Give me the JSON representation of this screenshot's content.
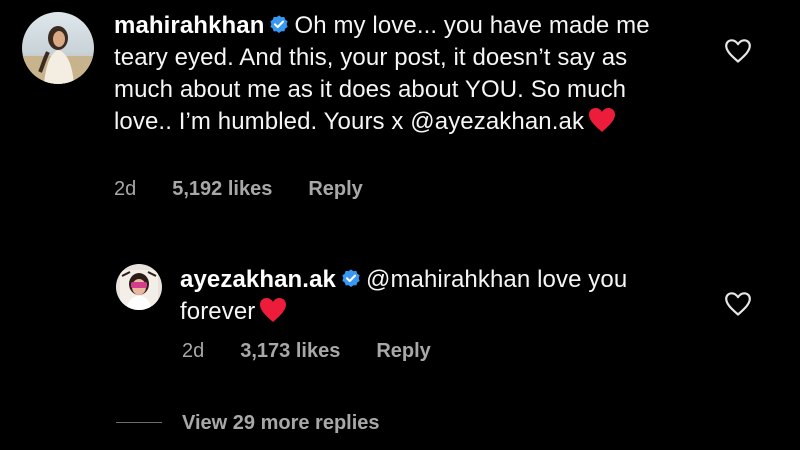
{
  "comment": {
    "username": "mahirahkhan",
    "text": "Oh my love... you have made me teary eyed. And this, your post, it doesn’t say as much about me as it does about YOU. So much love.. I’m humbled. Yours x @ayezakhan.ak",
    "emoji": "red-heart",
    "time": "2d",
    "likes": "5,192 likes",
    "reply_label": "Reply"
  },
  "reply": {
    "username": "ayezakhan.ak",
    "mention": "@mahirahkhan",
    "text_line1": "love you",
    "text_line2": "forever",
    "emoji": "red-heart",
    "time": "2d",
    "likes": "3,173 likes",
    "reply_label": "Reply"
  },
  "view_more": "View 29 more replies",
  "colors": {
    "background": "#000000",
    "text": "#f5f5f5",
    "secondary": "#a8a8a8",
    "verified": "#3897f0",
    "heart": "#ed1c3a"
  },
  "icons": {
    "verified": "verified-badge-icon",
    "like": "heart-outline-icon"
  }
}
